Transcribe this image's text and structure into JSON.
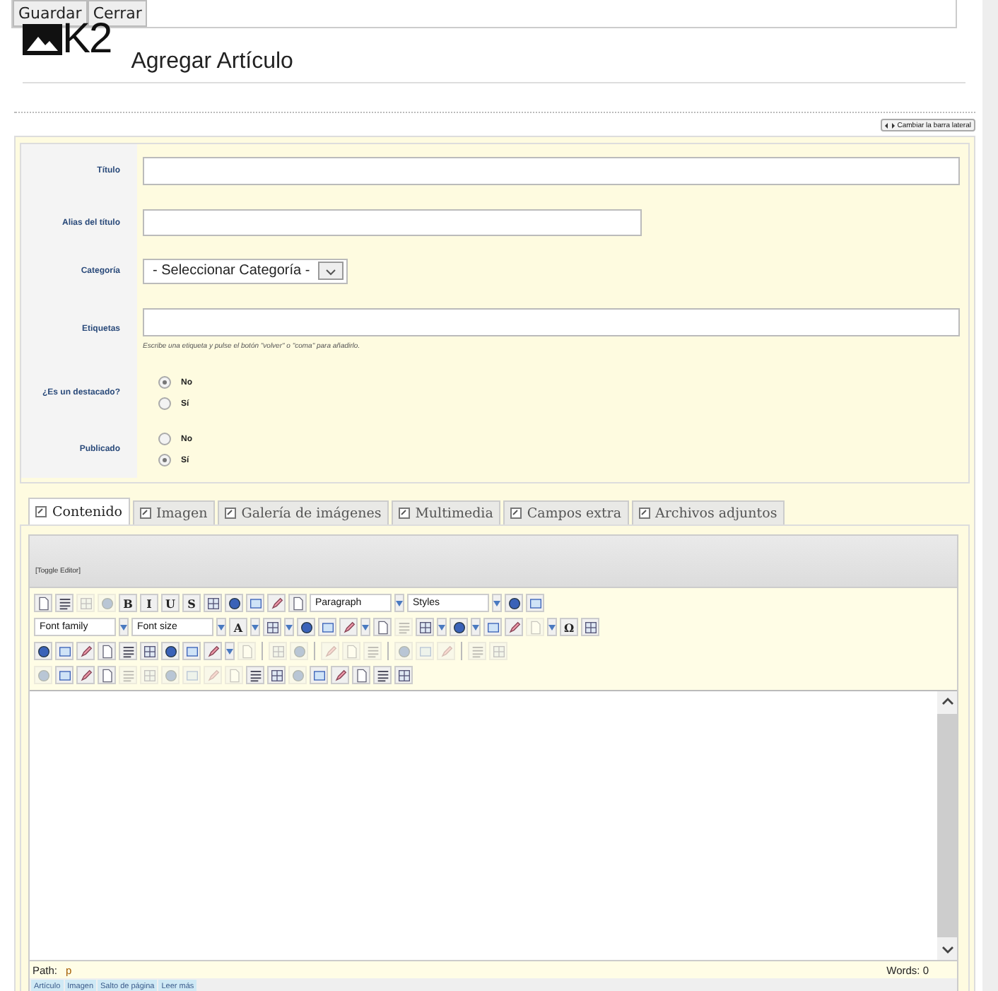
{
  "toolbar": {
    "buttons": [
      {
        "label": "Guardar"
      },
      {
        "label": "Cerrar"
      }
    ]
  },
  "header": {
    "logo_text": "K2",
    "title": "Agregar Artículo"
  },
  "sidebar_toggle": {
    "label": "Cambiar la barra lateral"
  },
  "form": {
    "fields": [
      {
        "kind": "text",
        "label": "Título"
      },
      {
        "kind": "short_text",
        "label": "Alias del título"
      },
      {
        "kind": "select",
        "label": "Categoría",
        "value": "- Seleccionar Categoría -"
      },
      {
        "kind": "text",
        "label": "Etiquetas",
        "hint": "Escribe una etiqueta y pulse el botón \"volver\" o \"coma\" para añadirlo."
      },
      {
        "kind": "radio",
        "label": "¿Es un destacado?",
        "options": [
          {
            "label": "No",
            "selected": true
          },
          {
            "label": "Sí",
            "selected": false
          }
        ]
      },
      {
        "kind": "radio",
        "label": "Publicado",
        "options": [
          {
            "label": "No",
            "selected": false
          },
          {
            "label": "Sí",
            "selected": true
          }
        ]
      }
    ]
  },
  "tabs": [
    {
      "label": "Contenido",
      "selected": true
    },
    {
      "label": "Imagen",
      "selected": false
    },
    {
      "label": "Galería de imágenes",
      "selected": false
    },
    {
      "label": "Multimedia",
      "selected": false
    },
    {
      "label": "Campos extra",
      "selected": false
    },
    {
      "label": "Archivos adjuntos",
      "selected": false
    }
  ],
  "editor": {
    "toggle_label": "[Toggle Editor]",
    "toolbar_rows": [
      [
        {
          "kind": "icon",
          "disabled": false
        },
        {
          "kind": "icon",
          "disabled": false
        },
        {
          "kind": "icon",
          "disabled": true
        },
        {
          "kind": "icon",
          "disabled": true
        },
        {
          "kind": "glyph",
          "text": "B",
          "disabled": false
        },
        {
          "kind": "glyph",
          "text": "I",
          "disabled": false
        },
        {
          "kind": "glyph",
          "text": "U",
          "disabled": false
        },
        {
          "kind": "glyph",
          "text": "S",
          "disabled": false
        },
        {
          "kind": "icon",
          "disabled": false
        },
        {
          "kind": "icon",
          "disabled": false
        },
        {
          "kind": "icon",
          "disabled": false
        },
        {
          "kind": "icon",
          "disabled": false
        },
        {
          "kind": "icon",
          "disabled": false
        },
        {
          "kind": "select",
          "label": "Paragraph"
        },
        {
          "kind": "select",
          "label": "Styles"
        },
        {
          "kind": "icon",
          "disabled": false
        },
        {
          "kind": "icon",
          "disabled": false
        }
      ],
      [
        {
          "kind": "select",
          "label": "Font family"
        },
        {
          "kind": "select",
          "label": "Font size"
        },
        {
          "kind": "glyph",
          "text": "A",
          "disabled": false,
          "dropdown": true
        },
        {
          "kind": "icon",
          "disabled": false,
          "dropdown": true
        },
        {
          "kind": "icon",
          "disabled": false
        },
        {
          "kind": "icon",
          "disabled": false
        },
        {
          "kind": "icon",
          "disabled": false,
          "dropdown": true
        },
        {
          "kind": "icon",
          "disabled": false
        },
        {
          "kind": "icon",
          "disabled": true
        },
        {
          "kind": "icon",
          "disabled": false,
          "dropdown": true
        },
        {
          "kind": "icon",
          "disabled": false,
          "dropdown": true
        },
        {
          "kind": "icon",
          "disabled": false
        },
        {
          "kind": "icon",
          "disabled": false
        },
        {
          "kind": "icon",
          "disabled": true,
          "dropdown": true
        },
        {
          "kind": "glyph",
          "text": "Ω",
          "disabled": false
        },
        {
          "kind": "icon",
          "disabled": false
        }
      ],
      [
        {
          "kind": "icon",
          "disabled": false
        },
        {
          "kind": "icon",
          "disabled": false
        },
        {
          "kind": "icon",
          "disabled": false
        },
        {
          "kind": "icon",
          "disabled": false
        },
        {
          "kind": "icon",
          "disabled": false
        },
        {
          "kind": "icon",
          "disabled": false
        },
        {
          "kind": "icon",
          "disabled": false
        },
        {
          "kind": "icon",
          "disabled": false
        },
        {
          "kind": "icon",
          "disabled": false,
          "dropdown": true
        },
        {
          "kind": "icon",
          "disabled": true
        },
        {
          "kind": "separator"
        },
        {
          "kind": "icon",
          "disabled": true
        },
        {
          "kind": "icon",
          "disabled": true
        },
        {
          "kind": "separator"
        },
        {
          "kind": "icon",
          "disabled": true
        },
        {
          "kind": "icon",
          "disabled": true
        },
        {
          "kind": "icon",
          "disabled": true
        },
        {
          "kind": "separator"
        },
        {
          "kind": "icon",
          "disabled": true
        },
        {
          "kind": "icon",
          "disabled": true
        },
        {
          "kind": "icon",
          "disabled": true
        },
        {
          "kind": "separator"
        },
        {
          "kind": "icon",
          "disabled": true
        },
        {
          "kind": "icon",
          "disabled": true
        }
      ],
      [
        {
          "kind": "icon",
          "disabled": true
        },
        {
          "kind": "icon",
          "disabled": false
        },
        {
          "kind": "icon",
          "disabled": false
        },
        {
          "kind": "icon",
          "disabled": false
        },
        {
          "kind": "icon",
          "disabled": true
        },
        {
          "kind": "icon",
          "disabled": true
        },
        {
          "kind": "icon",
          "disabled": true
        },
        {
          "kind": "icon",
          "disabled": true
        },
        {
          "kind": "icon",
          "disabled": true
        },
        {
          "kind": "icon",
          "disabled": true
        },
        {
          "kind": "icon",
          "disabled": false
        },
        {
          "kind": "icon",
          "disabled": false
        },
        {
          "kind": "icon",
          "disabled": true
        },
        {
          "kind": "icon",
          "disabled": false
        },
        {
          "kind": "icon",
          "disabled": false
        },
        {
          "kind": "icon",
          "disabled": false
        },
        {
          "kind": "icon",
          "disabled": false
        },
        {
          "kind": "icon",
          "disabled": false
        }
      ]
    ],
    "path_label": "Path:",
    "path_value": "p",
    "word_count": "Words: 0",
    "buttons": [
      {
        "label": "Artículo"
      },
      {
        "label": "Imagen"
      },
      {
        "label": "Salto de página"
      },
      {
        "label": "Leer más"
      }
    ]
  }
}
